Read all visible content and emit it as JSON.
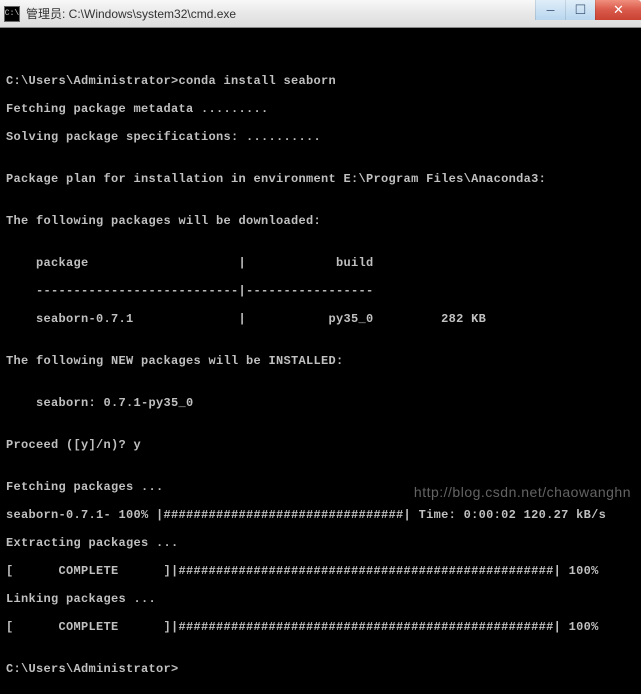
{
  "window": {
    "icon_label": "C:\\",
    "title": "管理员: C:\\Windows\\system32\\cmd.exe",
    "buttons": {
      "minimize": "—",
      "maximize": "☐",
      "close": "✕"
    }
  },
  "terminal": {
    "blank1": "",
    "blank2": "",
    "prompt1": "C:\\Users\\Administrator>conda install seaborn",
    "fetch_meta": "Fetching package metadata .........",
    "solving": "Solving package specifications: ..........",
    "blank3": "",
    "plan": "Package plan for installation in environment E:\\Program Files\\Anaconda3:",
    "blank4": "",
    "dl_header": "The following packages will be downloaded:",
    "blank5": "",
    "tbl_head": "    package                    |            build",
    "tbl_sep": "    ---------------------------|-----------------",
    "tbl_row": "    seaborn-0.7.1              |           py35_0         282 KB",
    "blank6": "",
    "install_header": "The following NEW packages will be INSTALLED:",
    "blank7": "",
    "install_pkg": "    seaborn: 0.7.1-py35_0",
    "blank8": "",
    "proceed": "Proceed ([y]/n)? y",
    "blank9": "",
    "fetch_pkg": "Fetching packages ...",
    "seaborn_bar": "seaborn-0.7.1- 100% |################################| Time: 0:00:02 120.27 kB/s",
    "extract": "Extracting packages ...",
    "complete1": "[      COMPLETE      ]|##################################################| 100%",
    "linking": "Linking packages ...",
    "complete2": "[      COMPLETE      ]|##################################################| 100%",
    "blank10": "",
    "prompt2": "C:\\Users\\Administrator>"
  },
  "watermark": "http://blog.csdn.net/chaowanghn"
}
